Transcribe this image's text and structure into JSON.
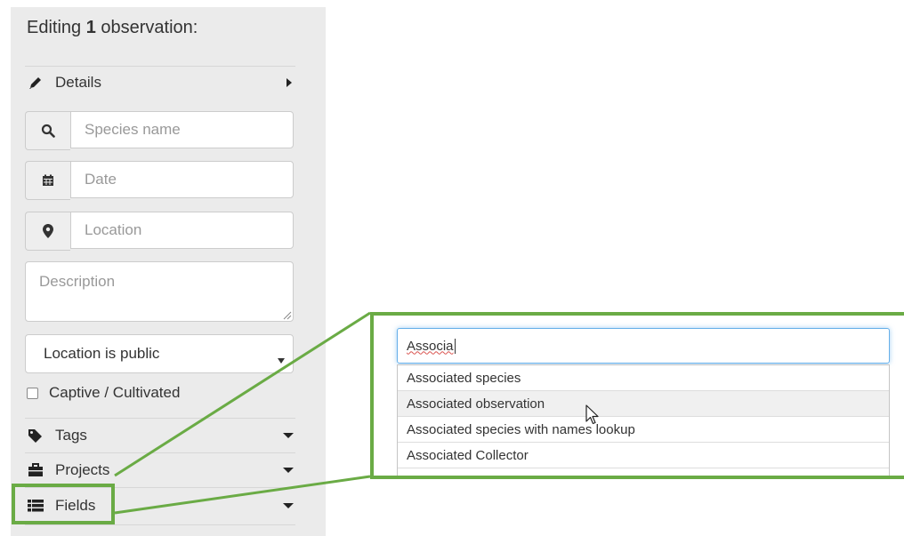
{
  "panel": {
    "title_prefix": "Editing ",
    "title_count": "1",
    "title_suffix": " observation:",
    "details_label": "Details",
    "species_placeholder": "Species name",
    "date_placeholder": "Date",
    "location_placeholder": "Location",
    "description_placeholder": "Description",
    "location_visibility": "Location is public",
    "captive_label": "Captive / Cultivated",
    "tags_label": "Tags",
    "projects_label": "Projects",
    "fields_label": "Fields"
  },
  "callout": {
    "search_value": "Associa",
    "suggestions": [
      "Associated species",
      "Associated observation",
      "Associated species with names lookup",
      "Associated Collector"
    ]
  },
  "icons": {
    "details": "pencil-icon",
    "species": "search-icon",
    "date": "calendar-icon",
    "location": "map-marker-icon",
    "tags": "tag-icon",
    "projects": "briefcase-icon",
    "fields": "list-icon"
  },
  "colors": {
    "highlight": "#6aab45",
    "panel_bg": "#ebebeb",
    "focus": "#66afe9"
  }
}
